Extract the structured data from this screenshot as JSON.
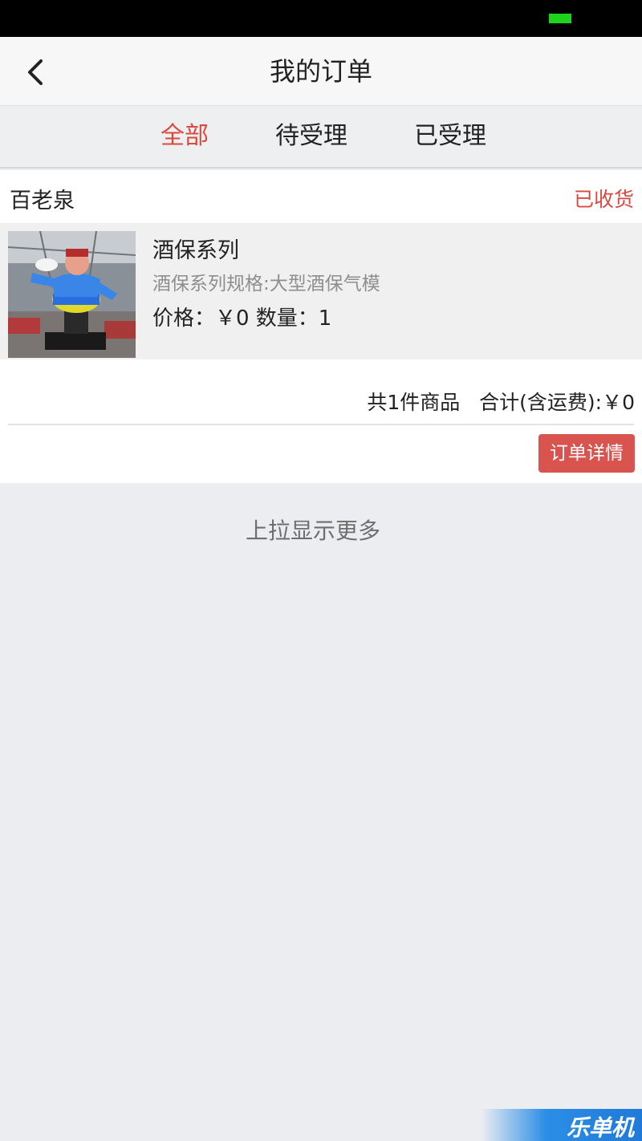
{
  "nav": {
    "title": "我的订单"
  },
  "tabs": [
    {
      "label": "全部",
      "active": true
    },
    {
      "label": "待受理",
      "active": false
    },
    {
      "label": "已受理",
      "active": false
    }
  ],
  "order": {
    "shop_name": "百老泉",
    "status": "已收货",
    "product": {
      "name": "酒保系列",
      "spec": "酒保系列规格:大型酒保气模",
      "price_qty": "价格：￥0 数量：1"
    },
    "summary": "共1件商品   合计(含运费):￥0",
    "detail_button": "订单详情"
  },
  "load_more": "上拉显示更多",
  "watermark": "乐单机",
  "colors": {
    "accent": "#d9493f",
    "button": "#d9534f",
    "battery": "#1bd41b"
  },
  "icons": {
    "back": "chevron-left-icon",
    "battery": "battery-icon"
  }
}
